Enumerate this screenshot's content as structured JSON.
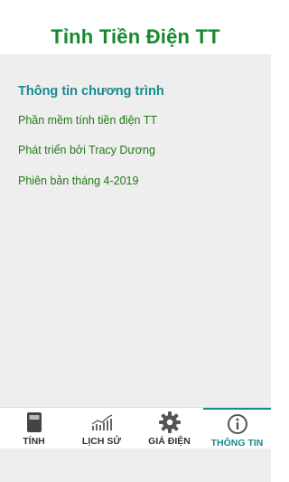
{
  "status": {
    "mark": ","
  },
  "header": {
    "title": "Tỉnh Tiền Điện TT"
  },
  "info": {
    "section_title": "Thông tin chương trình",
    "lines": [
      "Phần mềm tính tiền điện TT",
      "Phát triển bởi Tracy Dương",
      "Phiên bản tháng 4-2019"
    ]
  },
  "nav": {
    "items": [
      {
        "label": "TÍNH",
        "icon": "calculator-icon"
      },
      {
        "label": "LỊCH SỬ",
        "icon": "chart-icon"
      },
      {
        "label": "GIÁ ĐIỆN",
        "icon": "gear-icon"
      },
      {
        "label": "THÔNG TIN",
        "icon": "info-icon"
      }
    ],
    "active_index": 3
  },
  "colors": {
    "title": "#158a2b",
    "accent": "#1a8a8e",
    "text_green": "#1f7a14",
    "background": "#eeeeee"
  }
}
